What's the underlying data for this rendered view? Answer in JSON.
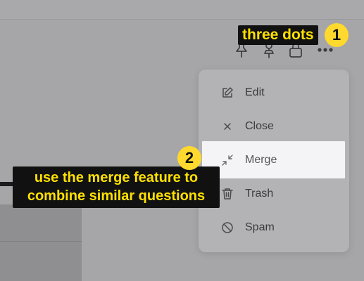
{
  "annotations": {
    "step1_label": "three dots",
    "step1_number": "1",
    "step2_line1": "use the merge feature to",
    "step2_line2": "combine similar questions",
    "step2_number": "2"
  },
  "toolbar": {
    "icons": [
      "pin-icon",
      "pin-alt-icon",
      "lock-icon",
      "more-dots-icon"
    ]
  },
  "menu": {
    "items": [
      {
        "label": "Edit",
        "icon": "edit-icon"
      },
      {
        "label": "Close",
        "icon": "close-icon"
      },
      {
        "label": "Merge",
        "icon": "merge-icon"
      },
      {
        "label": "Trash",
        "icon": "trash-icon"
      },
      {
        "label": "Spam",
        "icon": "spam-icon"
      }
    ]
  },
  "colors": {
    "overlay": "#a6a6a8",
    "annotation_bg": "#111111",
    "annotation_text": "#ffe000",
    "badge": "#ffd92e",
    "highlight": "#f4f4f6"
  }
}
